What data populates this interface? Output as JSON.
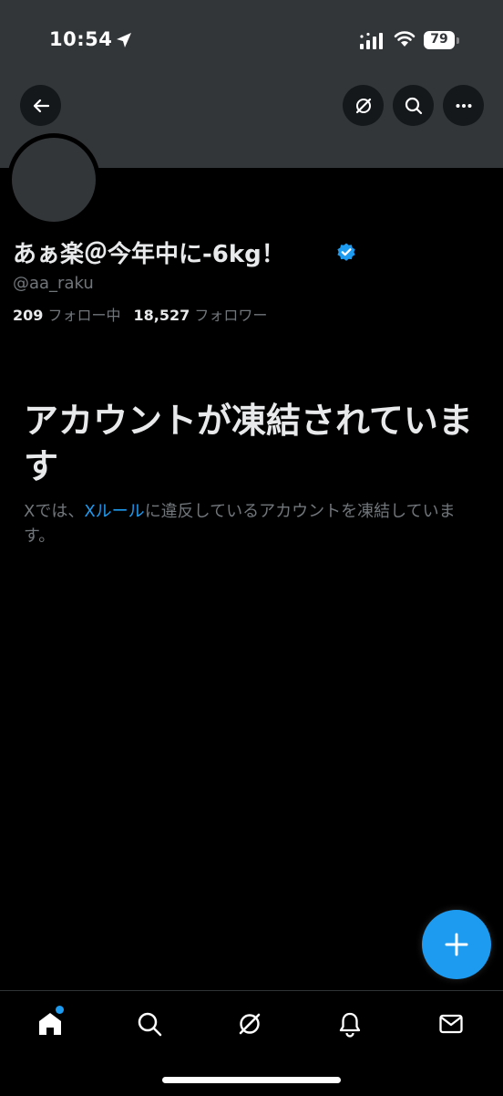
{
  "status_bar": {
    "time": "10:54",
    "battery": "79",
    "icons": [
      "location-arrow-icon",
      "cellular-signal-icon",
      "wifi-icon",
      "battery-icon"
    ]
  },
  "header": {
    "buttons": [
      "back-arrow-icon",
      "grok-icon",
      "search-icon",
      "more-icon"
    ]
  },
  "profile": {
    "display_name": "あぁ楽＠今年中に-6kg！",
    "handle": "@aa_raku",
    "following_count": "209",
    "following_label": "フォロー中",
    "followers_count": "18,527",
    "followers_label": "フォロワー",
    "verified": true
  },
  "suspension": {
    "title": "アカウントが凍結されています",
    "body_prefix": "Xでは、",
    "body_link": "Xルール",
    "body_suffix": "に違反しているアカウントを凍結しています。"
  },
  "tabbar": {
    "tabs": [
      "home-icon",
      "search-icon",
      "grok-icon",
      "notifications-bell-icon",
      "messages-envelope-icon"
    ],
    "home_has_notification": true
  },
  "colors": {
    "accent": "#1d9bf0",
    "background": "#000000",
    "header_banner": "#333639",
    "secondary_text": "#71767b"
  }
}
